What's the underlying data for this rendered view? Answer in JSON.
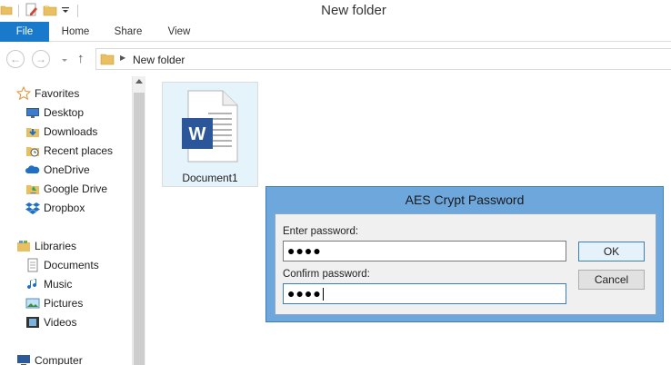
{
  "window": {
    "title": "New folder"
  },
  "ribbon": {
    "tabs": [
      {
        "label": "File"
      },
      {
        "label": "Home"
      },
      {
        "label": "Share"
      },
      {
        "label": "View"
      }
    ]
  },
  "address": {
    "path": "New folder"
  },
  "navpane": {
    "favorites_label": "Favorites",
    "favorites": [
      {
        "label": "Desktop",
        "icon": "desktop-icon"
      },
      {
        "label": "Downloads",
        "icon": "downloads-icon"
      },
      {
        "label": "Recent places",
        "icon": "recent-places-icon"
      },
      {
        "label": "OneDrive",
        "icon": "onedrive-icon"
      },
      {
        "label": "Google Drive",
        "icon": "google-drive-icon"
      },
      {
        "label": "Dropbox",
        "icon": "dropbox-icon"
      }
    ],
    "libraries_label": "Libraries",
    "libraries": [
      {
        "label": "Documents",
        "icon": "documents-icon"
      },
      {
        "label": "Music",
        "icon": "music-icon"
      },
      {
        "label": "Pictures",
        "icon": "pictures-icon"
      },
      {
        "label": "Videos",
        "icon": "videos-icon"
      }
    ],
    "computer_label": "Computer"
  },
  "content": {
    "files": [
      {
        "name": "Document1",
        "icon": "word-document-icon"
      }
    ]
  },
  "dialog": {
    "title": "AES Crypt Password",
    "enter_label": "Enter password:",
    "enter_value": "●●●●",
    "confirm_label": "Confirm password:",
    "confirm_value": "●●●●",
    "ok_label": "OK",
    "cancel_label": "Cancel"
  },
  "colors": {
    "file_tab": "#1979ca",
    "dialog_frame": "#6ea7dc",
    "selection": "#e5f3fb",
    "word_blue": "#2b579a"
  }
}
